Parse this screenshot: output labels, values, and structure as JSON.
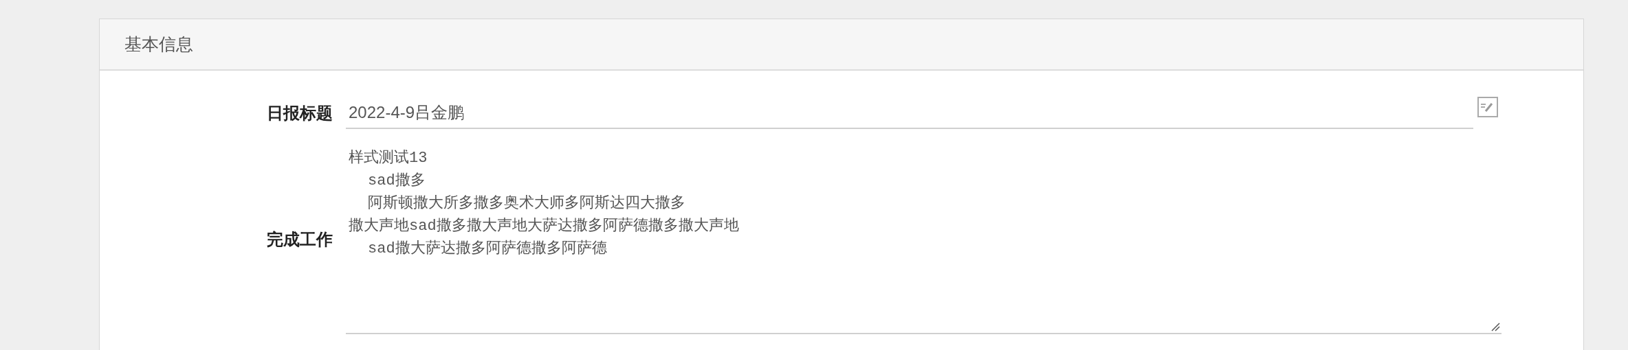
{
  "panel": {
    "title": "基本信息"
  },
  "fields": [
    {
      "kind": "input",
      "label": "日报标题",
      "value": "2022-4-9吕金鹏"
    },
    {
      "kind": "textarea",
      "label": "完成工作",
      "lines": [
        {
          "text": "样式测试13",
          "indented": false
        },
        {
          "text": "sad撒多",
          "indented": true
        },
        {
          "text": "阿斯顿撒大所多撒多奥术大师多阿斯达四大撒多",
          "indented": true
        },
        {
          "text": "撒大声地sad撒多撒大声地大萨达撒多阿萨德撒多撒大声地",
          "indented": false
        },
        {
          "text": "sad撒大萨达撒多阿萨德撒多阿萨德",
          "indented": true
        }
      ]
    }
  ]
}
